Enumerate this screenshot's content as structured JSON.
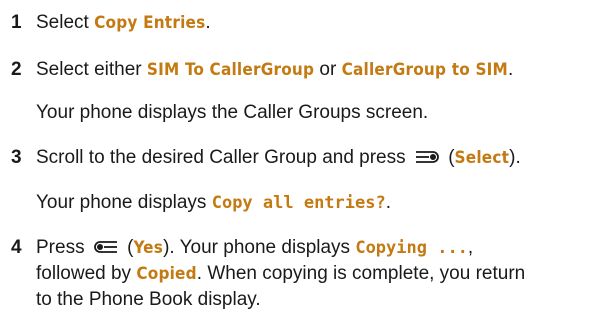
{
  "steps": [
    {
      "number": "1",
      "parts": {
        "a": "Select ",
        "cmd1": "Copy Entries",
        "b": "."
      }
    },
    {
      "number": "2",
      "parts": {
        "a": "Select either ",
        "cmd1": "SIM To CallerGroup",
        "b": " or ",
        "cmd2": "CallerGroup to SIM",
        "c": "."
      },
      "result": "Your phone displays the Caller Groups screen."
    },
    {
      "number": "3",
      "parts": {
        "a": "Scroll to the desired Caller Group and press ",
        "icon": "right-soft-key-icon",
        "b": " (",
        "cmd1": "Select",
        "c": ")."
      },
      "result_parts": {
        "a": "Your phone displays ",
        "cmd1": "Copy all entries?",
        "b": "."
      }
    },
    {
      "number": "4",
      "parts": {
        "a": "Press ",
        "icon": "left-soft-key-icon",
        "b": " (",
        "cmd1": "Yes",
        "c": "). Your phone displays ",
        "cmd2": "Copying ...",
        "d": ","
      },
      "line2_parts": {
        "a": "followed by ",
        "cmd1": "Copied",
        "b": ". When copying is complete, you return"
      },
      "line3": "to the Phone Book display."
    }
  ],
  "colors": {
    "command_text": "#c47a12",
    "body_text": "#1a1a1a"
  }
}
